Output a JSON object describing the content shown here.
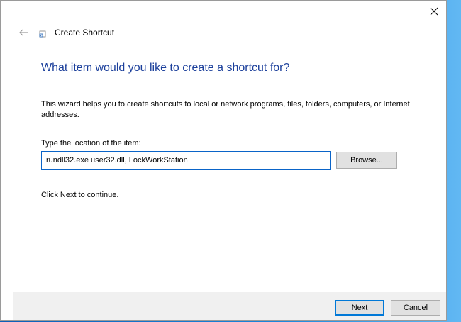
{
  "window": {
    "title": "Create Shortcut",
    "close_icon": "close-icon",
    "back_icon": "back-arrow-icon",
    "title_icon": "shortcut-icon"
  },
  "content": {
    "heading": "What item would you like to create a shortcut for?",
    "description": "This wizard helps you to create shortcuts to local or network programs, files, folders, computers, or Internet addresses.",
    "location_label": "Type the location of the item:",
    "location_value": "rundll32.exe user32.dll, LockWorkStation",
    "browse_label": "Browse...",
    "continue_text": "Click Next to continue."
  },
  "footer": {
    "next_label": "Next",
    "cancel_label": "Cancel"
  },
  "colors": {
    "heading": "#1b3f9b",
    "accent": "#0078d7",
    "desktop": "#1a86dc"
  }
}
